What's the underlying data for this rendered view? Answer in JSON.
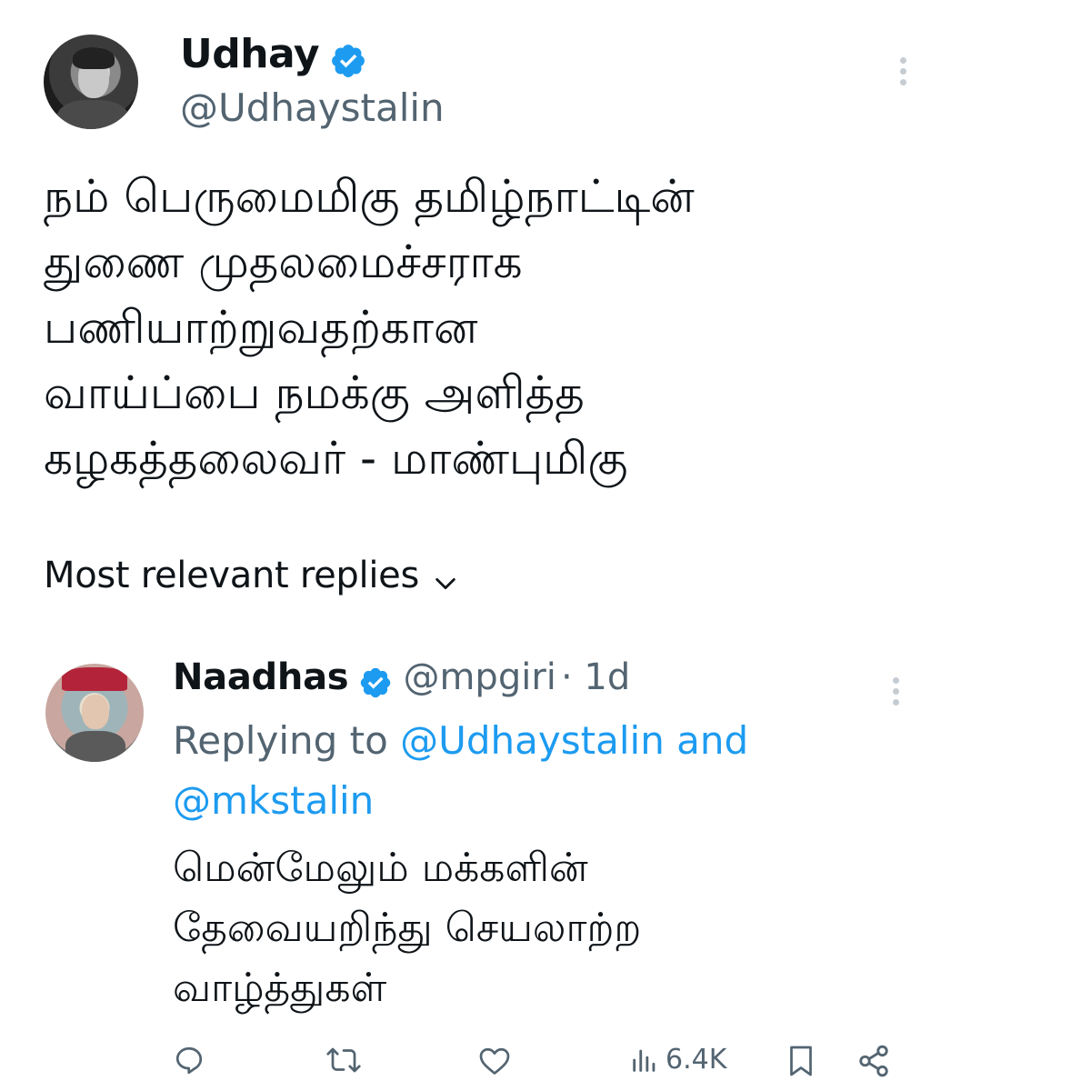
{
  "tweet": {
    "author_name": "Udhay",
    "author_handle": "@Udhaystalin",
    "lines": [
      "நம் பெருமைமிகு தமிழ்நாட்டின்",
      "துணை முதலமைச்சராக",
      "பணியாற்றுவதற்கான",
      "வாய்ப்பை நமக்கு அளித்த",
      "கழகத்தலைவர் - மாண்புமிகு"
    ]
  },
  "replies_sort": {
    "label": "Most relevant replies"
  },
  "reply": {
    "author_name": "Naadhas",
    "author_handle": "@mpgiri",
    "time": "· 1d",
    "replying_prefix": "Replying to",
    "mention_1": "@Udhaystalin and",
    "mention_2": "@mkstalin",
    "lines": [
      "மென்மேலும் மக்களின்",
      "தேவையறிந்து செயலாற்ற",
      "வாழ்த்துகள்"
    ],
    "views": "6.4K"
  },
  "colors": {
    "verified_blue": "#1d9bf0",
    "link_blue": "#1d9bf0",
    "muted": "#536471"
  },
  "icons": [
    "verified-badge-icon",
    "more-icon",
    "chevron-down-icon",
    "reply-icon",
    "retweet-icon",
    "like-icon",
    "views-icon",
    "bookmark-icon",
    "share-icon"
  ]
}
